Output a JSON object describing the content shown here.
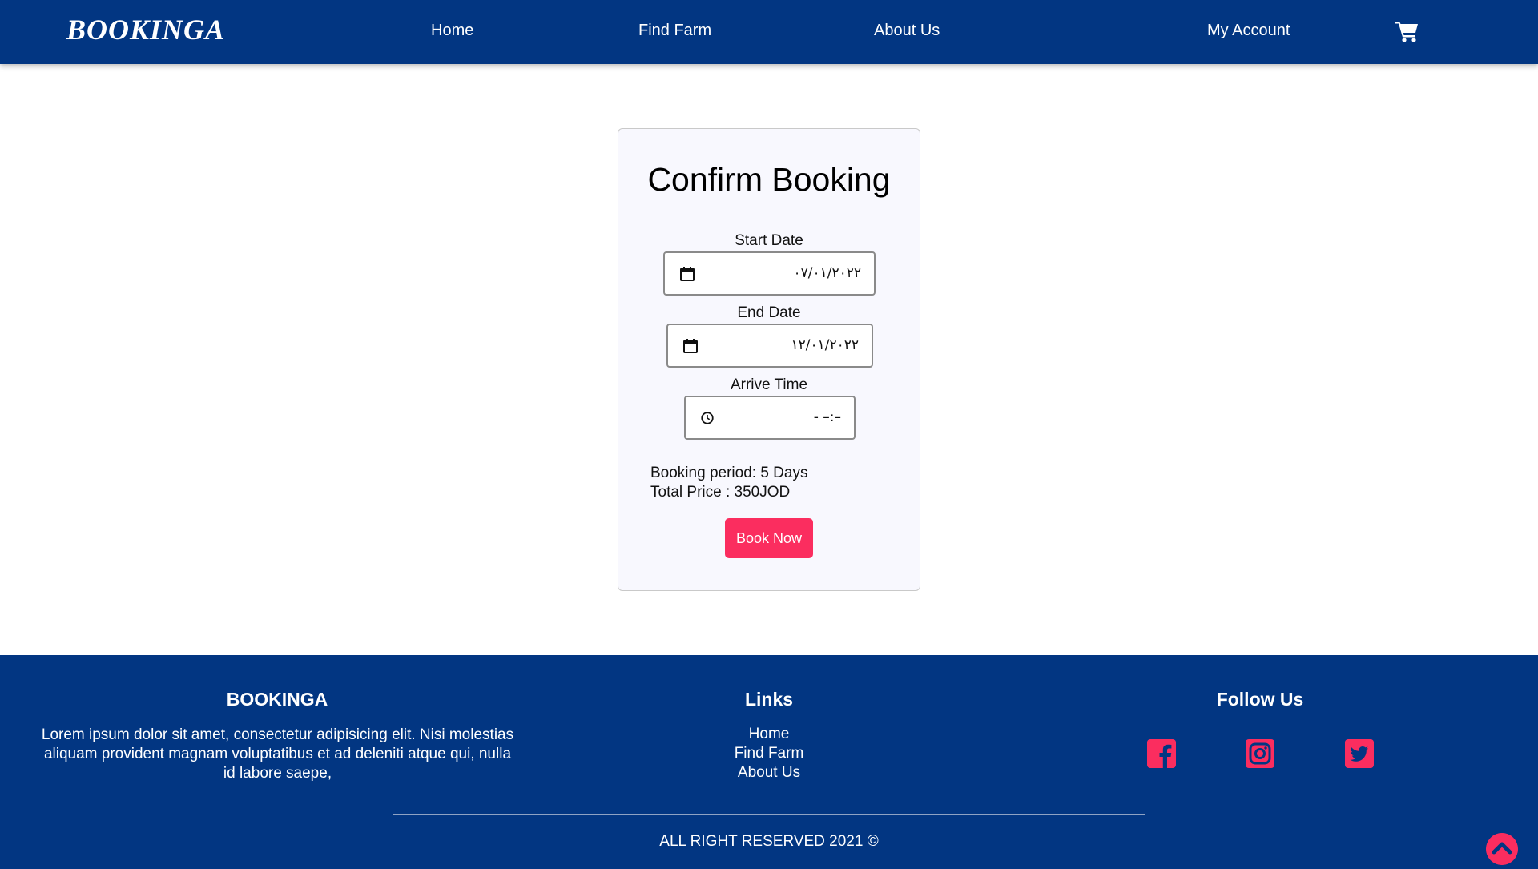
{
  "nav": {
    "brand": "BOOKINGA",
    "links": [
      "Home",
      "Find Farm",
      "About Us",
      "My Account"
    ],
    "cart_icon": "shopping-cart-icon"
  },
  "booking": {
    "title": "Confirm Booking",
    "start_date": {
      "label": "Start Date",
      "value": "٠٧/٠١/٢٠٢٢",
      "icon": "calendar-icon"
    },
    "end_date": {
      "label": "End Date",
      "value": "١٢/٠١/٢٠٢٢",
      "icon": "calendar-icon"
    },
    "arrive_time": {
      "label": "Arrive Time",
      "value": "- –:–",
      "icon": "clock-icon"
    },
    "period": "Booking period: 5 Days",
    "total": "Total Price : 350JOD",
    "button": "Book Now"
  },
  "footer": {
    "brand_title": "BOOKINGA",
    "about_text": "Lorem ipsum dolor sit amet, consectetur adipisicing elit. Nisi molestias aliquam provident magnam voluptatibus et ad deleniti atque qui, nulla id labore saepe,",
    "links_title": "Links",
    "links": [
      "Home",
      "Find Farm",
      "About Us"
    ],
    "follow_title": "Follow Us",
    "social_icons": [
      "facebook-icon",
      "instagram-icon",
      "twitter-icon"
    ],
    "copyright": "ALL RIGHT RESERVED 2021 ©"
  },
  "colors": {
    "primary": "#023682",
    "accent": "#fb2d5f",
    "card_bg": "#f8f8fe"
  }
}
